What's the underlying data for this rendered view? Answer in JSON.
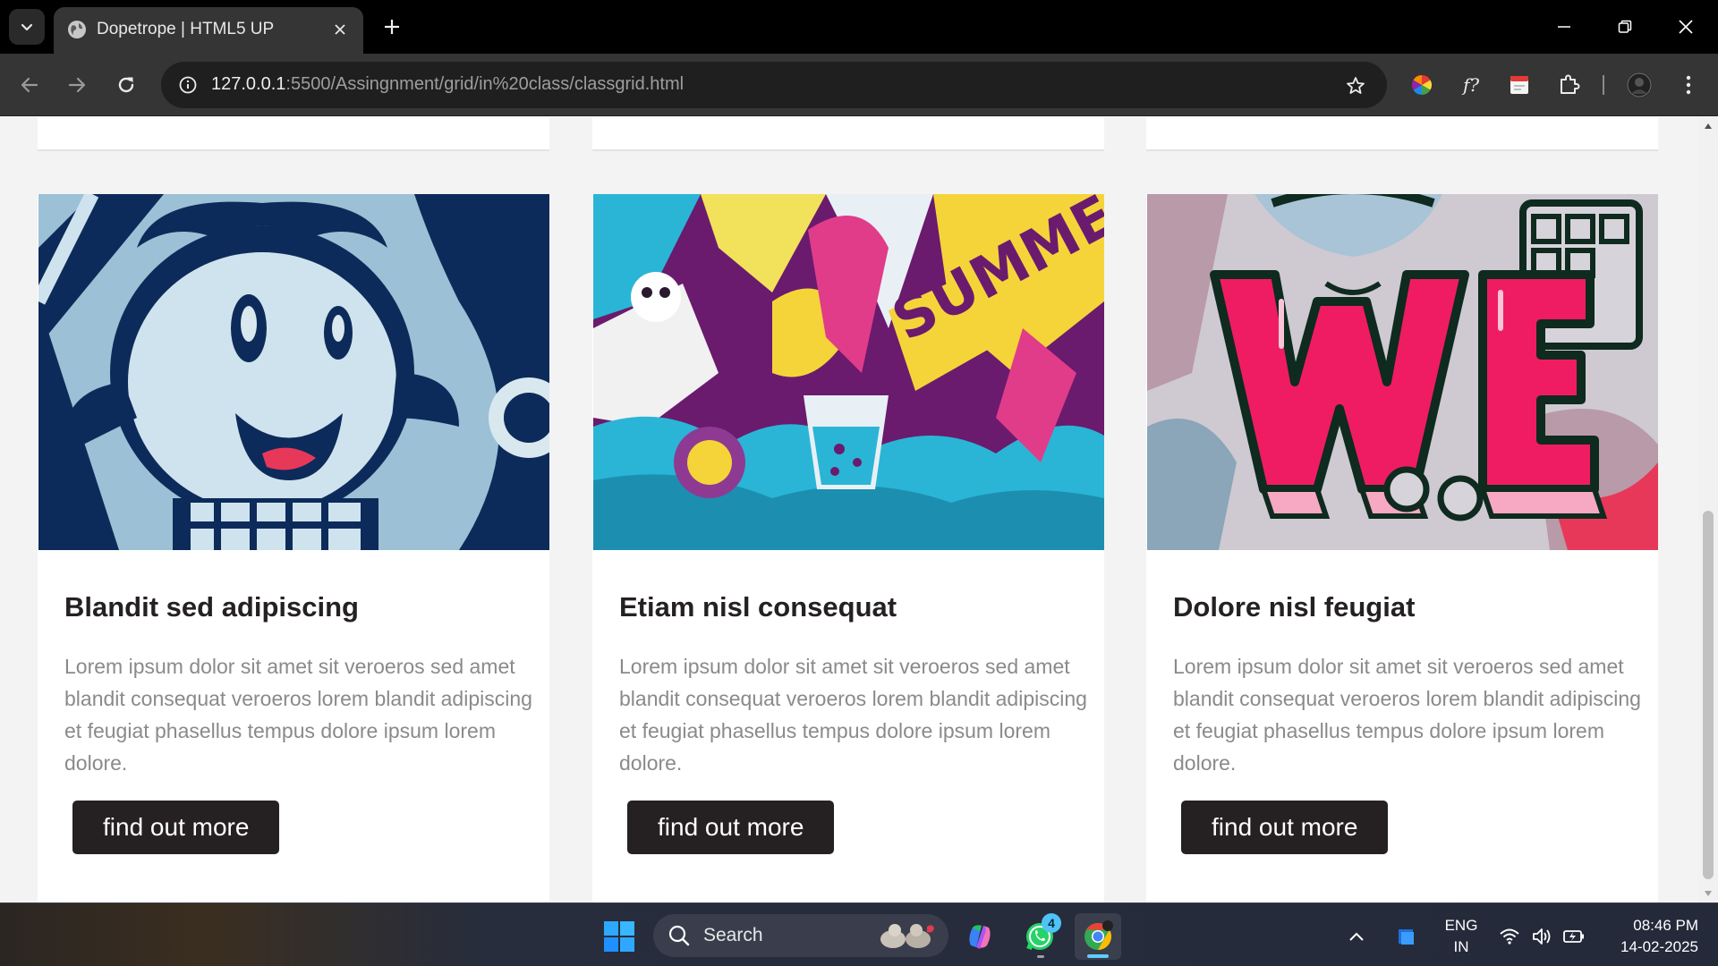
{
  "browser": {
    "tab_title": "Dopetrope | HTML5 UP",
    "url_host": "127.0.0.1",
    "url_path": ":5500/Assingnment/grid/in%20class/classgrid.html"
  },
  "cards": [
    {
      "title": "Blandit sed adipiscing",
      "text": "Lorem ipsum dolor sit amet sit veroeros sed amet blandit consequat veroeros lorem blandit adipiscing et feugiat phasellus tempus dolore ipsum lorem dolore.",
      "button": "find out more",
      "image": "cartoon-character-illustration"
    },
    {
      "title": "Etiam nisl consequat",
      "text": "Lorem ipsum dolor sit amet sit veroeros sed amet blandit consequat veroeros lorem blandit adipiscing et feugiat phasellus tempus dolore ipsum lorem dolore.",
      "button": "find out more",
      "image": "summer-graffiti-illustration",
      "image_text": "SUMME"
    },
    {
      "title": "Dolore nisl feugiat",
      "text": "Lorem ipsum dolor sit amet sit veroeros sed amet blandit consequat veroeros lorem blandit adipiscing et feugiat phasellus tempus dolore ipsum lorem dolore.",
      "button": "find out more",
      "image": "we-letters-illustration",
      "image_text": "WE"
    }
  ],
  "taskbar": {
    "search_label": "Search",
    "whatsapp_badge": "4",
    "lang_line1": "ENG",
    "lang_line2": "IN",
    "time": "08:46 PM",
    "date": "14-02-2025"
  },
  "colors": {
    "button_bg": "#252122",
    "title_text": "#252122",
    "body_text": "#8a8a8a",
    "page_bg": "#f3f3f3"
  }
}
